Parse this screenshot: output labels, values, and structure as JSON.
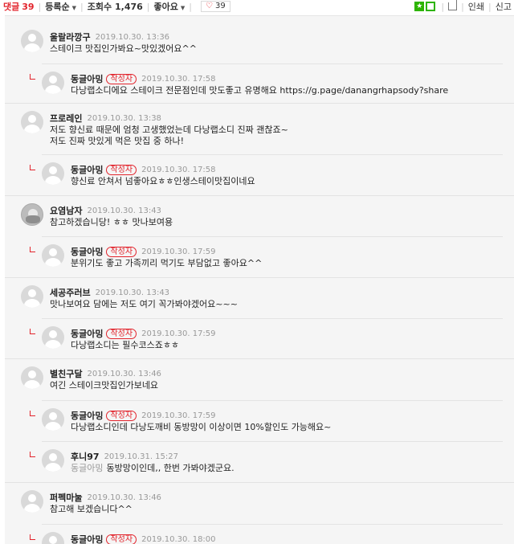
{
  "toolbar": {
    "comments_label": "댓글",
    "comments_count": "39",
    "sort_label": "등록순",
    "views_label": "조회수",
    "views_count": "1,476",
    "likes_label": "좋아요",
    "heart_count": "39",
    "print_label": "인쇄",
    "report_label": "신고"
  },
  "comments": [
    {
      "author": "울랄라깡구",
      "date": "2019.10.30. 13:36",
      "text": "스테이크 맛집인가봐요~맛있겠어요^^"
    },
    {
      "author": "동글아밍",
      "badge": "작성자",
      "date": "2019.10.30. 17:58",
      "text": "다낭랩소디에요 스테이크 전문점인데 맛도좋고 유명해요 https://g.page/danangrhapsody?share"
    },
    {
      "author": "프로레인",
      "date": "2019.10.30. 13:38",
      "text": "저도 향신료 때문에 엄청 고생했었는데 다낭랩소디 진짜 괜찮죠~\n저도 진짜 맛있게 먹은 맛집 중 하나!"
    },
    {
      "author": "동글아밍",
      "badge": "작성자",
      "date": "2019.10.30. 17:58",
      "text": "향신료 안쳐서 넘좋아요ㅎㅎ인생스테이맛집이네요"
    },
    {
      "author": "요염남자",
      "date": "2019.10.30. 13:43",
      "text": "참고하겠습니당! ㅎㅎ 맛나보여용"
    },
    {
      "author": "동글아밍",
      "badge": "작성자",
      "date": "2019.10.30. 17:59",
      "text": "분위기도 좋고 가족끼리 먹기도 부담없고 좋아요^^"
    },
    {
      "author": "세공주러브",
      "date": "2019.10.30. 13:43",
      "text": "맛나보여요 담에는 저도 여기 꼭가봐야겠어요~~~"
    },
    {
      "author": "동글아밍",
      "badge": "작성자",
      "date": "2019.10.30. 17:59",
      "text": "다낭랩소디는 필수코스죠ㅎㅎ"
    },
    {
      "author": "별친구달",
      "date": "2019.10.30. 13:46",
      "text": "여긴 스테이크맛집인가보네요"
    },
    {
      "author": "동글아밍",
      "badge": "작성자",
      "date": "2019.10.30. 17:59",
      "text": "다낭랩소디인데 다낭도깨비 동방망이 이상이면 10%할인도 가능해요~"
    },
    {
      "author": "후니97",
      "date": "2019.10.31. 15:27",
      "mention": "동글아밍",
      "text": "동방망이인데,, 한번 가봐야겠군요."
    },
    {
      "author": "퍼펙마눌",
      "date": "2019.10.30. 13:46",
      "text": "참고해 보겠습니다^^"
    },
    {
      "author": "동글아밍",
      "badge": "작성자",
      "date": "2019.10.30. 18:00",
      "text": ""
    }
  ]
}
